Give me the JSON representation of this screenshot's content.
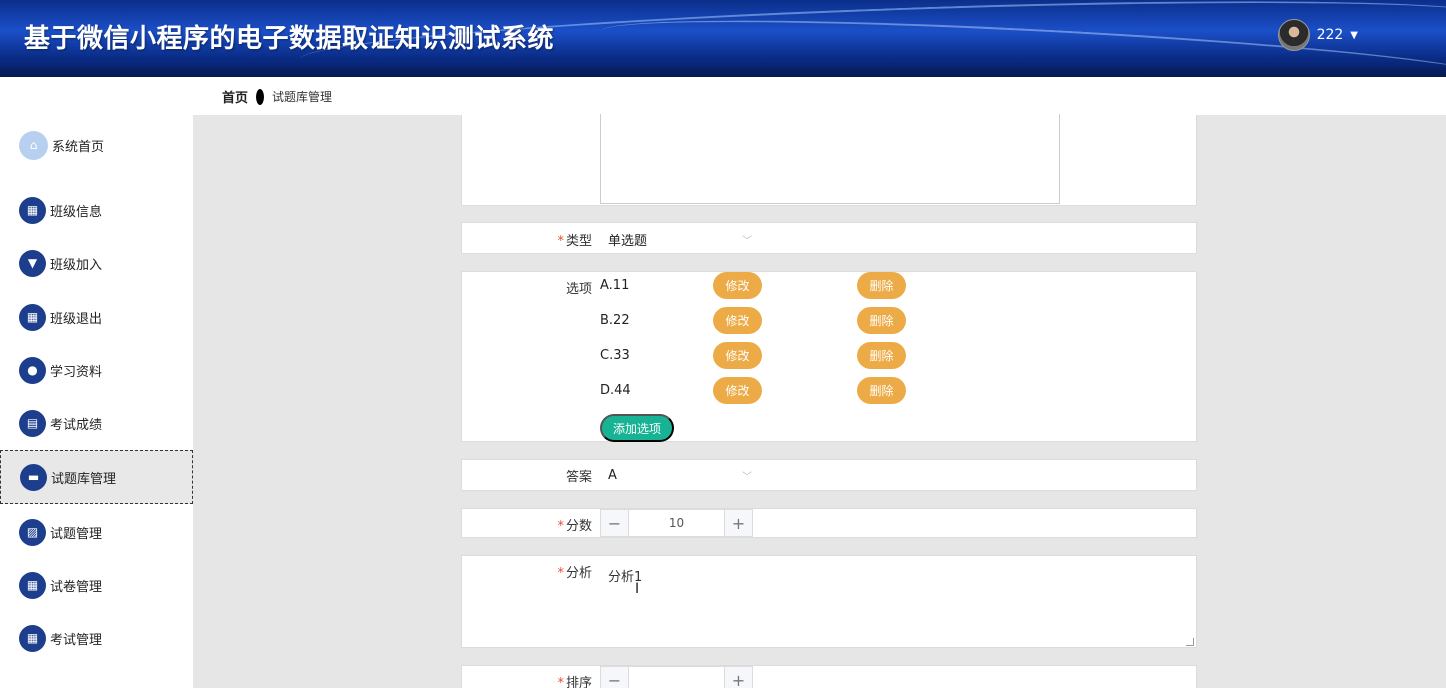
{
  "header": {
    "title": "基于微信小程序的电子数据取证知识测试系统",
    "username": "222",
    "caret": "▼"
  },
  "breadcrumb": {
    "home": "首页",
    "current": "试题库管理"
  },
  "sidebar": {
    "items": [
      {
        "label": "系统首页",
        "icon": "home-icon",
        "glyph": "⌂"
      },
      {
        "label": "班级信息",
        "icon": "grid-icon",
        "glyph": "▦"
      },
      {
        "label": "班级加入",
        "icon": "pin-icon",
        "glyph": "▼"
      },
      {
        "label": "班级退出",
        "icon": "grid-icon",
        "glyph": "▦"
      },
      {
        "label": "学习资料",
        "icon": "user-icon",
        "glyph": "●"
      },
      {
        "label": "考试成绩",
        "icon": "table-icon",
        "glyph": "▤"
      },
      {
        "label": "试题库管理",
        "icon": "briefcase-icon",
        "glyph": "▬"
      },
      {
        "label": "试题管理",
        "icon": "chart-icon",
        "glyph": "▨"
      },
      {
        "label": "试卷管理",
        "icon": "grid-icon",
        "glyph": "▦"
      },
      {
        "label": "考试管理",
        "icon": "grid-icon",
        "glyph": "▦"
      }
    ]
  },
  "form": {
    "type": {
      "label": "类型",
      "value": "单选题"
    },
    "options": {
      "label": "选项",
      "items": [
        "A.11",
        "B.22",
        "C.33",
        "D.44"
      ],
      "edit_label": "修改",
      "delete_label": "删除",
      "add_label": "添加选项"
    },
    "answer": {
      "label": "答案",
      "value": "A"
    },
    "score": {
      "label": "分数",
      "value": "10",
      "minus": "−",
      "plus": "+"
    },
    "analysis": {
      "label": "分析",
      "value": "分析1"
    },
    "sort": {
      "label": "排序",
      "minus": "−",
      "plus": "+"
    },
    "required_mark": "*",
    "chevron": "﹀"
  }
}
